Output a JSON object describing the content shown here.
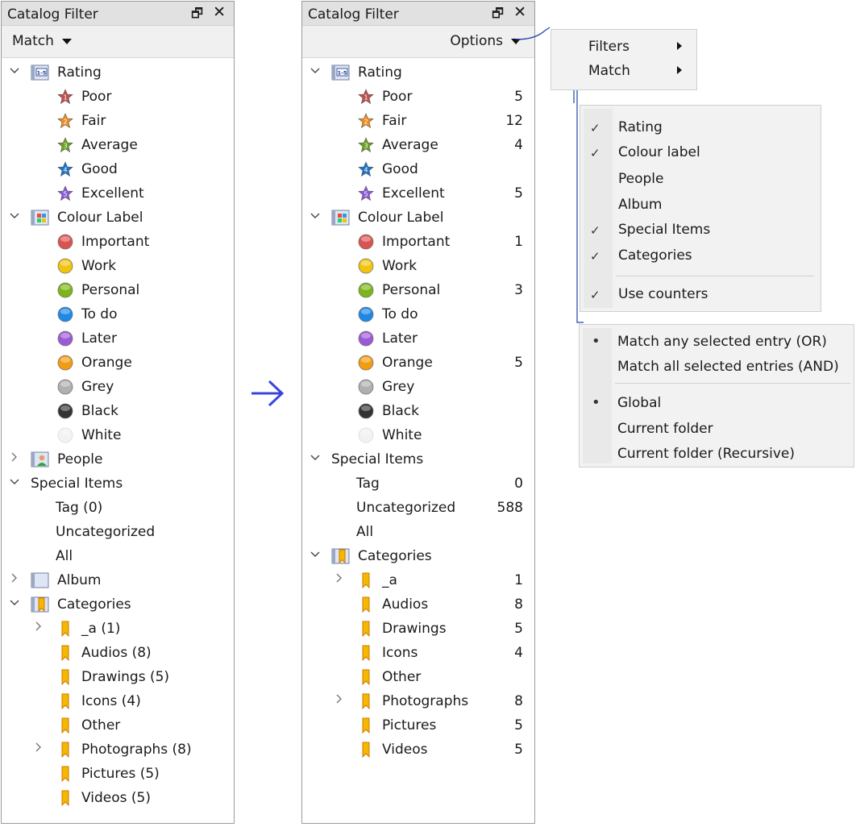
{
  "left_panel": {
    "title": "Catalog Filter",
    "restore_glyph": "🗗",
    "close_glyph": "✕",
    "match_label": "Match",
    "tree": [
      {
        "kind": "group",
        "label": "Rating",
        "icon": "rating-icon",
        "expanded": true,
        "level": 0
      },
      {
        "kind": "star",
        "label": "Poor",
        "num": "1",
        "color": "#c0504d",
        "level": 1
      },
      {
        "kind": "star",
        "label": "Fair",
        "num": "2",
        "color": "#f08c1e",
        "level": 1
      },
      {
        "kind": "star",
        "label": "Average",
        "num": "3",
        "color": "#6aa121",
        "level": 1
      },
      {
        "kind": "star",
        "label": "Good",
        "num": "4",
        "color": "#1e73c8",
        "level": 1
      },
      {
        "kind": "star",
        "label": "Excellent",
        "num": "5",
        "color": "#8a5ad6",
        "level": 1
      },
      {
        "kind": "group",
        "label": "Colour Label",
        "icon": "colour-label-icon",
        "expanded": true,
        "level": 0
      },
      {
        "kind": "dot",
        "label": "Important",
        "color": "#d9534f",
        "level": 1
      },
      {
        "kind": "dot",
        "label": "Work",
        "color": "#f1c40f",
        "level": 1
      },
      {
        "kind": "dot",
        "label": "Personal",
        "color": "#7cb518",
        "level": 1
      },
      {
        "kind": "dot",
        "label": "To do",
        "color": "#1e88e5",
        "level": 1
      },
      {
        "kind": "dot",
        "label": "Later",
        "color": "#9b59d6",
        "level": 1
      },
      {
        "kind": "dot",
        "label": "Orange",
        "color": "#f39c12",
        "level": 1
      },
      {
        "kind": "dot",
        "label": "Grey",
        "color": "#b0b0b0",
        "level": 1
      },
      {
        "kind": "dot",
        "label": "Black",
        "color": "#333333",
        "level": 1
      },
      {
        "kind": "dot",
        "label": "White",
        "color": "#f2f2f2",
        "level": 1
      },
      {
        "kind": "group",
        "label": "People",
        "icon": "people-icon",
        "expanded": false,
        "level": 0
      },
      {
        "kind": "group",
        "label": "Special Items",
        "icon": "",
        "expanded": true,
        "level": 0
      },
      {
        "kind": "plain",
        "label": "Tag (0)",
        "level": 1
      },
      {
        "kind": "plain",
        "label": "Uncategorized",
        "level": 1
      },
      {
        "kind": "plain",
        "label": "All",
        "level": 1
      },
      {
        "kind": "group",
        "label": "Album",
        "icon": "album-icon",
        "expanded": false,
        "level": 0
      },
      {
        "kind": "group",
        "label": "Categories",
        "icon": "categories-icon",
        "expanded": true,
        "level": 0
      },
      {
        "kind": "cat",
        "label": "_a (1)",
        "level": 1,
        "collapsible": true
      },
      {
        "kind": "cat",
        "label": "Audios (8)",
        "level": 1
      },
      {
        "kind": "cat",
        "label": "Drawings (5)",
        "level": 1
      },
      {
        "kind": "cat",
        "label": "Icons (4)",
        "level": 1
      },
      {
        "kind": "cat",
        "label": "Other",
        "level": 1
      },
      {
        "kind": "cat",
        "label": "Photographs (8)",
        "level": 1,
        "collapsible": true
      },
      {
        "kind": "cat",
        "label": "Pictures (5)",
        "level": 1
      },
      {
        "kind": "cat",
        "label": "Videos (5)",
        "level": 1
      }
    ]
  },
  "right_panel": {
    "title": "Catalog Filter",
    "restore_glyph": "🗗",
    "close_glyph": "✕",
    "options_label": "Options",
    "tree": [
      {
        "kind": "group",
        "label": "Rating",
        "icon": "rating-icon",
        "expanded": true,
        "level": 0,
        "count": ""
      },
      {
        "kind": "star",
        "label": "Poor",
        "num": "1",
        "color": "#c0504d",
        "level": 1,
        "count": "5"
      },
      {
        "kind": "star",
        "label": "Fair",
        "num": "2",
        "color": "#f08c1e",
        "level": 1,
        "count": "12"
      },
      {
        "kind": "star",
        "label": "Average",
        "num": "3",
        "color": "#6aa121",
        "level": 1,
        "count": "4"
      },
      {
        "kind": "star",
        "label": "Good",
        "num": "4",
        "color": "#1e73c8",
        "level": 1,
        "count": ""
      },
      {
        "kind": "star",
        "label": "Excellent",
        "num": "5",
        "color": "#8a5ad6",
        "level": 1,
        "count": "5"
      },
      {
        "kind": "group",
        "label": "Colour Label",
        "icon": "colour-label-icon",
        "expanded": true,
        "level": 0,
        "count": ""
      },
      {
        "kind": "dot",
        "label": "Important",
        "color": "#d9534f",
        "level": 1,
        "count": "1"
      },
      {
        "kind": "dot",
        "label": "Work",
        "color": "#f1c40f",
        "level": 1,
        "count": ""
      },
      {
        "kind": "dot",
        "label": "Personal",
        "color": "#7cb518",
        "level": 1,
        "count": "3"
      },
      {
        "kind": "dot",
        "label": "To do",
        "color": "#1e88e5",
        "level": 1,
        "count": ""
      },
      {
        "kind": "dot",
        "label": "Later",
        "color": "#9b59d6",
        "level": 1,
        "count": ""
      },
      {
        "kind": "dot",
        "label": "Orange",
        "color": "#f39c12",
        "level": 1,
        "count": "5"
      },
      {
        "kind": "dot",
        "label": "Grey",
        "color": "#b0b0b0",
        "level": 1,
        "count": ""
      },
      {
        "kind": "dot",
        "label": "Black",
        "color": "#333333",
        "level": 1,
        "count": ""
      },
      {
        "kind": "dot",
        "label": "White",
        "color": "#f2f2f2",
        "level": 1,
        "count": ""
      },
      {
        "kind": "group",
        "label": "Special Items",
        "icon": "",
        "expanded": true,
        "level": 0,
        "count": ""
      },
      {
        "kind": "plain",
        "label": "Tag",
        "level": 1,
        "count": "0"
      },
      {
        "kind": "plain",
        "label": "Uncategorized",
        "level": 1,
        "count": "588"
      },
      {
        "kind": "plain",
        "label": "All",
        "level": 1,
        "count": ""
      },
      {
        "kind": "group",
        "label": "Categories",
        "icon": "categories-icon",
        "expanded": true,
        "level": 0,
        "count": ""
      },
      {
        "kind": "cat",
        "label": "_a",
        "level": 1,
        "collapsible": true,
        "count": "1"
      },
      {
        "kind": "cat",
        "label": "Audios",
        "level": 1,
        "count": "8"
      },
      {
        "kind": "cat",
        "label": "Drawings",
        "level": 1,
        "count": "5"
      },
      {
        "kind": "cat",
        "label": "Icons",
        "level": 1,
        "count": "4"
      },
      {
        "kind": "cat",
        "label": "Other",
        "level": 1,
        "count": ""
      },
      {
        "kind": "cat",
        "label": "Photographs",
        "level": 1,
        "collapsible": true,
        "count": "8"
      },
      {
        "kind": "cat",
        "label": "Pictures",
        "level": 1,
        "count": "5"
      },
      {
        "kind": "cat",
        "label": "Videos",
        "level": 1,
        "count": "5"
      }
    ]
  },
  "options_menu": {
    "items": [
      {
        "label": "Filters"
      },
      {
        "label": "Match"
      }
    ]
  },
  "filters_menu": {
    "items": [
      {
        "label": "Rating",
        "checked": true
      },
      {
        "label": "Colour label",
        "checked": true
      },
      {
        "label": "People",
        "checked": false
      },
      {
        "label": "Album",
        "checked": false
      },
      {
        "label": "Special Items",
        "checked": true
      },
      {
        "label": "Categories",
        "checked": true
      },
      {
        "label": "Use counters",
        "checked": true
      }
    ]
  },
  "match_menu": {
    "items": [
      {
        "label": "Match any selected entry (OR)",
        "selected": true
      },
      {
        "label": "Match all selected entries (AND)",
        "selected": false
      },
      {
        "label": "Global",
        "selected": true
      },
      {
        "label": "Current folder",
        "selected": false
      },
      {
        "label": "Current folder (Recursive)",
        "selected": false
      }
    ]
  },
  "colors": {
    "accent_arrow": "#3a46d6",
    "connector": "#1f3fa8"
  }
}
